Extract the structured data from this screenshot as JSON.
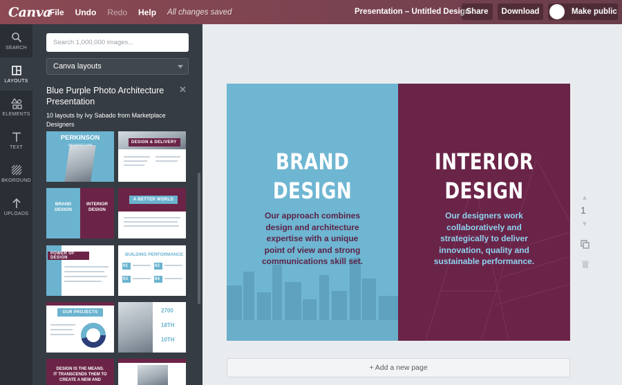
{
  "topbar": {
    "logo": "Canva",
    "menu": [
      "File",
      "Undo",
      "Redo",
      "Help"
    ],
    "status": "All changes saved",
    "doc_title": "Presentation – Untitled Design",
    "share": "Share",
    "download": "Download",
    "make_public": "Make public"
  },
  "rail": {
    "items": [
      {
        "label": "SEARCH",
        "icon": "search-icon"
      },
      {
        "label": "LAYOUTS",
        "icon": "layouts-icon"
      },
      {
        "label": "ELEMENTS",
        "icon": "elements-icon"
      },
      {
        "label": "TEXT",
        "icon": "text-icon"
      },
      {
        "label": "BKGROUND",
        "icon": "background-icon"
      },
      {
        "label": "UPLOADS",
        "icon": "upload-icon"
      }
    ]
  },
  "panel": {
    "search_placeholder": "Search 1,000,000 images...",
    "select_value": "Canva layouts",
    "title": "Blue Purple Photo Architecture Presentation",
    "subtitle": "10 layouts by Ivy Sabado from Marketplace Designers",
    "thumbs": {
      "t1a": "PERKINSON",
      "t1b": "ARCHITECTURE",
      "t2": "DESIGN & DELIVERY",
      "t3a": "BRAND",
      "t3b": "DESIGN",
      "t3c": "INTERIOR",
      "t3d": "DESIGN",
      "t4": "A BETTER WORLD",
      "t5": "POWER OF DESIGN",
      "t6": "BUILDING PERFORMANCE",
      "t6n": [
        "01",
        "02",
        "03",
        "04"
      ],
      "t7": "OUR PROJECTS",
      "t8": [
        "2700",
        "18TH",
        "10TH"
      ],
      "t9": [
        "DESIGN IS THE MEANS.",
        "IT TRANSCENDS THEM TO",
        "CREATE A NEW AND"
      ]
    }
  },
  "slide": {
    "left_heading": [
      "BRAND",
      "DESIGN"
    ],
    "left_body": "Our approach combines design and architecture expertise with a unique point of view and strong communications skill set.",
    "right_heading": [
      "INTERIOR",
      "DESIGN"
    ],
    "right_body": "Our designers work collaboratively and strategically to deliver innovation, quality and sustainable performance.",
    "colors": {
      "blue": "#6fb6d2",
      "plum": "#6a2448",
      "body_text": "#5a2346",
      "right_body": "#8fd3f0"
    }
  },
  "page_number": "1",
  "add_page": "+ Add a new page"
}
